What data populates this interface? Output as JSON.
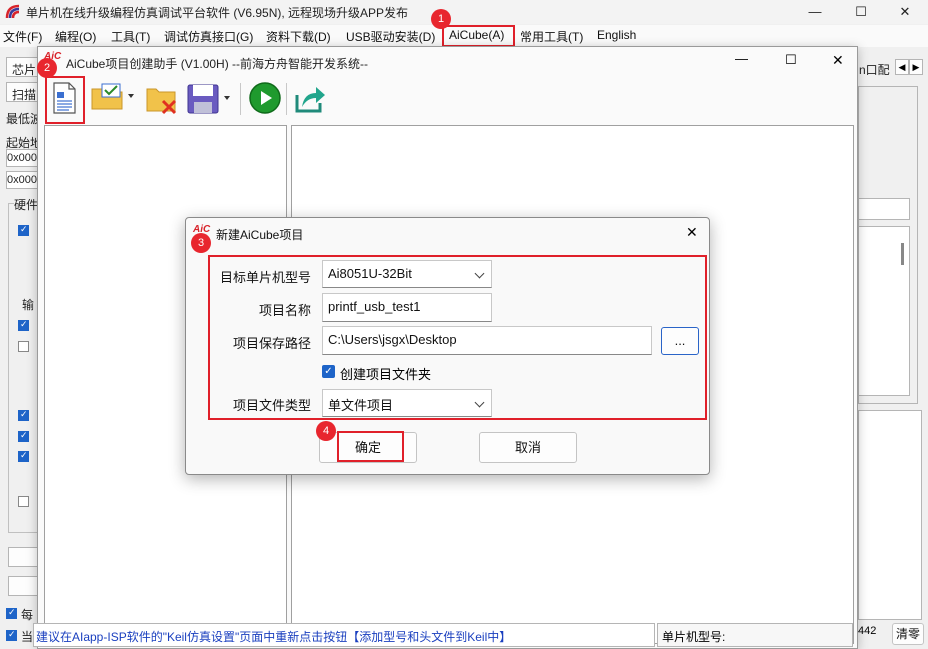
{
  "window": {
    "title": "单片机在线升级编程仿真调试平台软件 (V6.95N), 远程现场升级APP发布",
    "controls": {
      "minimize": "—",
      "maximize": "☐",
      "close": "✕"
    }
  },
  "menubar": {
    "items": [
      "文件(F)",
      "编程(O)",
      "工具(T)",
      "调试仿真接口(G)",
      "资料下载(D)",
      "USB驱动安装(D)",
      "AiCube(A)",
      "常用工具(T)",
      "English"
    ]
  },
  "annotations": {
    "badge1": "1",
    "badge2": "2",
    "badge3": "3",
    "badge4": "4"
  },
  "background_panel": {
    "chip_label": "芯片",
    "scan_label": "扫描",
    "min_label": "最低波",
    "start_label": "起始地",
    "addr1": "0x000",
    "addr2": "0x000",
    "hw_label": "硬件",
    "io_label": "输",
    "each_label": "每",
    "current_label": "当",
    "right_tab_label": "n口配",
    "count_value": "442",
    "clear_button": "清零"
  },
  "wizard": {
    "logo": "AiC",
    "title": "AiCube项目创建助手 (V1.00H)  --前海方舟智能开发系统--"
  },
  "dialog": {
    "logo": "AiC",
    "title": "新建AiCube项目",
    "close": "✕",
    "mcu_label": "目标单片机型号",
    "mcu_value": "Ai8051U-32Bit",
    "name_label": "项目名称",
    "name_value": "printf_usb_test1",
    "path_label": "项目保存路径",
    "path_value": "C:\\Users\\jsgx\\Desktop",
    "browse_label": "...",
    "create_folder_label": "创建项目文件夹",
    "create_folder_checked": true,
    "type_label": "项目文件类型",
    "type_value": "单文件项目",
    "ok_label": "确定",
    "cancel_label": "取消"
  },
  "statusbar": {
    "hint": "建议在AIapp-ISP软件的\"Keil仿真设置\"页面中重新点击按钮【添加型号和头文件到Keil中】",
    "mcu_type_label": "单片机型号:"
  },
  "colors": {
    "accent_red": "#e0202a",
    "checkbox_blue": "#1e64c8",
    "hint_blue": "#1a3fbf"
  }
}
